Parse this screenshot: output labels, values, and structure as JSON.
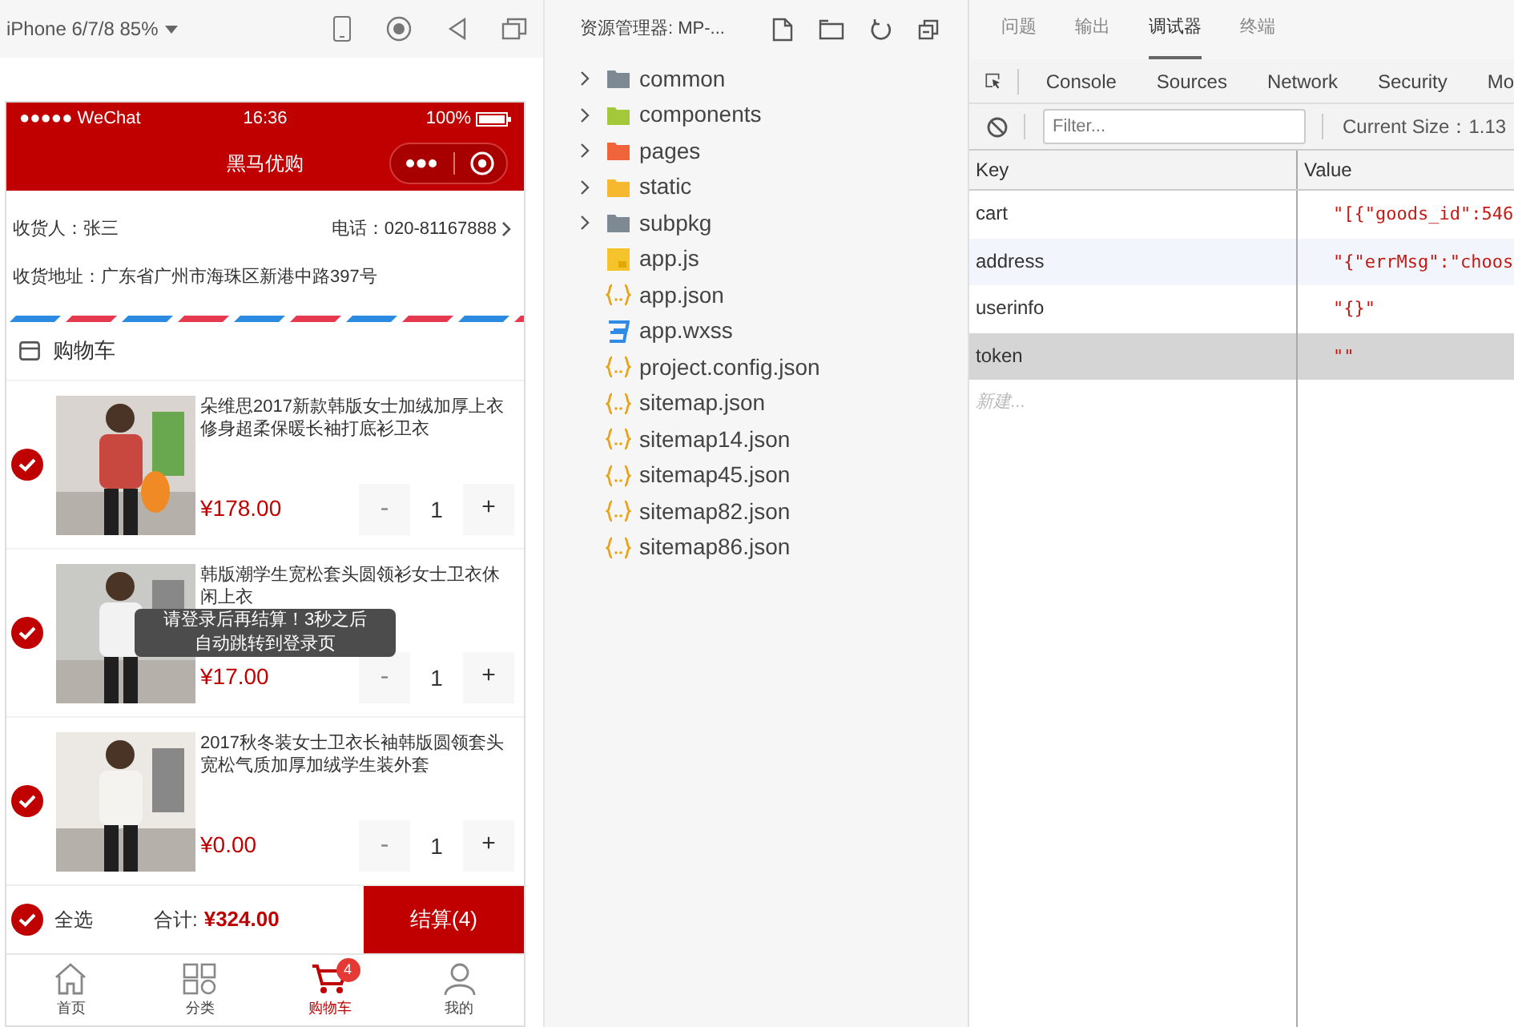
{
  "simulator": {
    "device": "iPhone 6/7/8 85%"
  },
  "phone": {
    "status_bar": {
      "carrier": "●●●●● WeChat",
      "time": "16:36",
      "battery": "100%"
    },
    "nav_title": "黑马优购",
    "address": {
      "receiver": "收货人：张三",
      "phone": "电话：020-81167888",
      "address": "收货地址：广东省广州市海珠区新港中路397号"
    },
    "cart_title": "购物车",
    "items": [
      {
        "title": "朵维思2017新款韩版女士加绒加厚上衣修身超柔保暖长袖打底衫卫衣",
        "price": "¥178.00",
        "qty": "1",
        "minus": "-",
        "plus": "+",
        "checked": true
      },
      {
        "title": "韩版潮学生宽松套头圆领衫女士卫衣休闲上衣",
        "price": "¥17.00",
        "qty": "1",
        "minus": "-",
        "plus": "+",
        "checked": true
      },
      {
        "title": "2017秋冬装女士卫衣长袖韩版圆领套头宽松气质加厚加绒学生装外套",
        "price": "¥0.00",
        "qty": "1",
        "minus": "-",
        "plus": "+",
        "checked": true
      }
    ],
    "footer": {
      "select_all": "全选",
      "checked": true,
      "total_label": "合计:",
      "total": "¥324.00",
      "checkout": "结算(4)"
    },
    "toast": "请登录后再结算！3秒之后自动跳转到登录页",
    "tabbar": [
      {
        "kind": "home",
        "label": "首页",
        "selected": false
      },
      {
        "kind": "category",
        "label": "分类",
        "selected": false
      },
      {
        "kind": "cart",
        "label": "购物车",
        "selected": true,
        "badge": "4"
      },
      {
        "kind": "profile",
        "label": "我的",
        "selected": false
      }
    ]
  },
  "explorer": {
    "title": "资源管理器: MP-...",
    "items": [
      {
        "kind": "folder",
        "name": "common",
        "color": "#7d8a94"
      },
      {
        "kind": "folder",
        "name": "components",
        "color": "#a3c93a"
      },
      {
        "kind": "folder",
        "name": "pages",
        "color": "#f0643c"
      },
      {
        "kind": "folder",
        "name": "static",
        "color": "#f5b82e"
      },
      {
        "kind": "folder",
        "name": "subpkg",
        "color": "#7d8a94"
      },
      {
        "kind": "js",
        "name": "app.js"
      },
      {
        "kind": "json",
        "name": "app.json"
      },
      {
        "kind": "css",
        "name": "app.wxss"
      },
      {
        "kind": "json",
        "name": "project.config.json"
      },
      {
        "kind": "json",
        "name": "sitemap.json"
      },
      {
        "kind": "json",
        "name": "sitemap14.json"
      },
      {
        "kind": "json",
        "name": "sitemap45.json"
      },
      {
        "kind": "json",
        "name": "sitemap82.json"
      },
      {
        "kind": "json",
        "name": "sitemap86.json"
      }
    ]
  },
  "devtools": {
    "tabs": [
      {
        "label": "问题",
        "selected": false
      },
      {
        "label": "输出",
        "selected": false
      },
      {
        "label": "调试器",
        "selected": true
      },
      {
        "label": "终端",
        "selected": false
      }
    ],
    "panel_tabs": [
      "Console",
      "Sources",
      "Network",
      "Security",
      "Mo"
    ],
    "filter": {
      "placeholder": "Filter..."
    },
    "current_size": "Current Size：1.13",
    "table": {
      "columns": [
        "Key",
        "Value"
      ],
      "rows": [
        {
          "key": "cart",
          "value": "\"[{\"goods_id\":546",
          "selected": false
        },
        {
          "key": "address",
          "value": "\"{\"errMsg\":\"choos",
          "selected": false
        },
        {
          "key": "userinfo",
          "value": "\"{}\"",
          "selected": false
        },
        {
          "key": "token",
          "value": "\"\"",
          "selected": true
        }
      ],
      "new_row": "新建..."
    }
  }
}
